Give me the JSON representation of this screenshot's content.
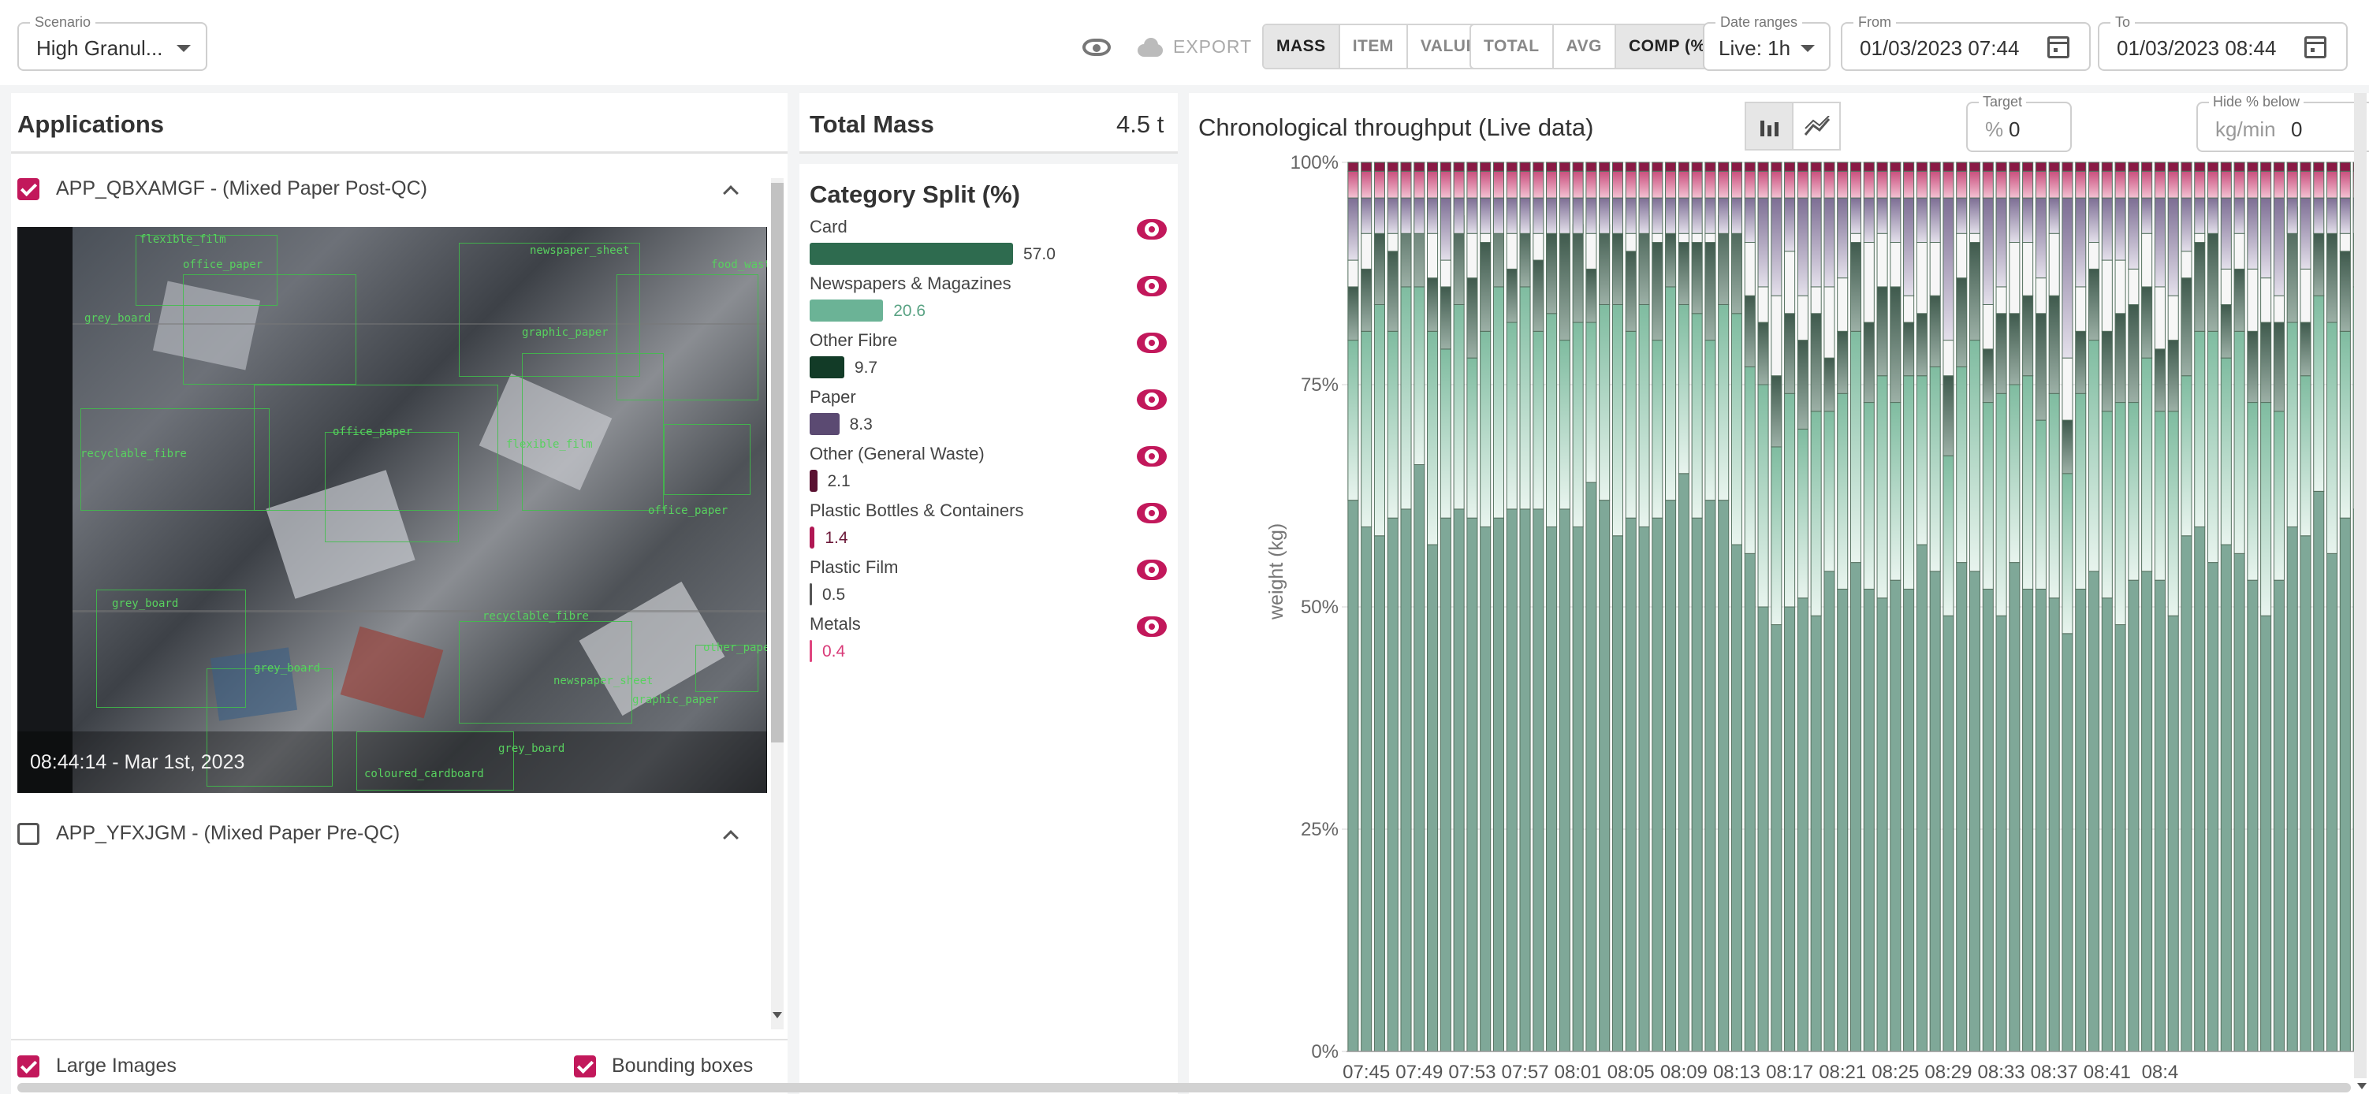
{
  "toolbar": {
    "scenario_label": "Scenario",
    "scenario_value": "High Granul...",
    "export_label": "EXPORT",
    "metric_buttons": [
      "MASS",
      "ITEM",
      "VALUE"
    ],
    "metric_active": "MASS",
    "agg_buttons": [
      "TOTAL",
      "AVG",
      "COMP (%)"
    ],
    "agg_active": "COMP (%)",
    "date_ranges_label": "Date ranges",
    "date_ranges_value": "Live: 1h",
    "from_label": "From",
    "from_value": "01/03/2023 07:44",
    "to_label": "To",
    "to_value": "01/03/2023 08:44"
  },
  "applications": {
    "title": "Applications",
    "items": [
      {
        "label": "APP_QBXAMGF - (Mixed Paper Post-QC)",
        "checked": true
      },
      {
        "label": "APP_YFXJGM - (Mixed Paper Pre-QC)",
        "checked": false
      }
    ],
    "image_timestamp": "08:44:14 - Mar 1st, 2023",
    "detection_labels": [
      "flexible_film",
      "office_paper",
      "newspaper_sheet",
      "grey_board",
      "food_waste",
      "graphic_paper",
      "recyclable_fibre",
      "other_paper",
      "coloured_cardboard"
    ],
    "large_images_label": "Large Images",
    "large_images_checked": true,
    "bounding_boxes_label": "Bounding boxes",
    "bounding_boxes_checked": true
  },
  "total_mass": {
    "label": "Total Mass",
    "value": "4.5 t"
  },
  "category_split": {
    "title": "Category Split (%)",
    "categories": [
      {
        "name": "Card",
        "value": 57.0,
        "display": "57.0",
        "color": "#2e6b4f",
        "text_color": "#444"
      },
      {
        "name": "Newspapers & Magazines",
        "value": 20.6,
        "display": "20.6",
        "color": "#6bb396",
        "text_color": "#5aa384"
      },
      {
        "name": "Other Fibre",
        "value": 9.7,
        "display": "9.7",
        "color": "#123b27",
        "text_color": "#444"
      },
      {
        "name": "Paper",
        "value": 8.3,
        "display": "8.3",
        "color": "#5b4a72",
        "text_color": "#444"
      },
      {
        "name": "Other (General Waste)",
        "value": 2.1,
        "display": "2.1",
        "color": "#5a1131",
        "text_color": "#444"
      },
      {
        "name": "Plastic Bottles & Containers",
        "value": 1.4,
        "display": "1.4",
        "color": "#b01753",
        "text_color": "#6b1838"
      },
      {
        "name": "Plastic Film",
        "value": 0.5,
        "display": "0.5",
        "color": "#555555",
        "text_color": "#444"
      },
      {
        "name": "Metals",
        "value": 0.4,
        "display": "0.4",
        "color": "#e0457f",
        "text_color": "#d93a78"
      }
    ]
  },
  "throughput": {
    "title": "Chronological throughput (Live data)",
    "target_label": "Target",
    "target_unit": "%",
    "target_value": "0",
    "hide_label": "Hide % below",
    "hide_unit": "kg/min",
    "hide_value": "0"
  },
  "chart_data": {
    "type": "bar",
    "stacked": true,
    "ylabel": "weight (kg)",
    "ylim": [
      0,
      100
    ],
    "ytick_labels": [
      "0%",
      "25%",
      "50%",
      "75%",
      "100%"
    ],
    "xtick_labels": [
      "07:45",
      "07:49",
      "07:53",
      "07:57",
      "08:01",
      "08:05",
      "08:09",
      "08:13",
      "08:17",
      "08:21",
      "08:25",
      "08:29",
      "08:33",
      "08:37",
      "08:41",
      "08:4"
    ],
    "series_colors": [
      "#7fa898",
      "#bfe2d3",
      "#4e6a5e",
      "#f4f4f4",
      "#9d91ad",
      "#d98aa8",
      "#f0a3c0",
      "#8a1a45"
    ],
    "card_pct": [
      62,
      59,
      58,
      60,
      61,
      66,
      57,
      60,
      61,
      60,
      59,
      60,
      61,
      61,
      61,
      59,
      61,
      59,
      64,
      62,
      58,
      60,
      59,
      60,
      62,
      65,
      60,
      62,
      62,
      57,
      56,
      50,
      48,
      50,
      51,
      49,
      54,
      52,
      55,
      52,
      51,
      53,
      52,
      57,
      54,
      49,
      55,
      54,
      52,
      49,
      55,
      52,
      52,
      51,
      47,
      52,
      54,
      51,
      48,
      53,
      54,
      53,
      49,
      58,
      59,
      55,
      57,
      56,
      53,
      49,
      53,
      59,
      58,
      63,
      56,
      60,
      61
    ]
  }
}
